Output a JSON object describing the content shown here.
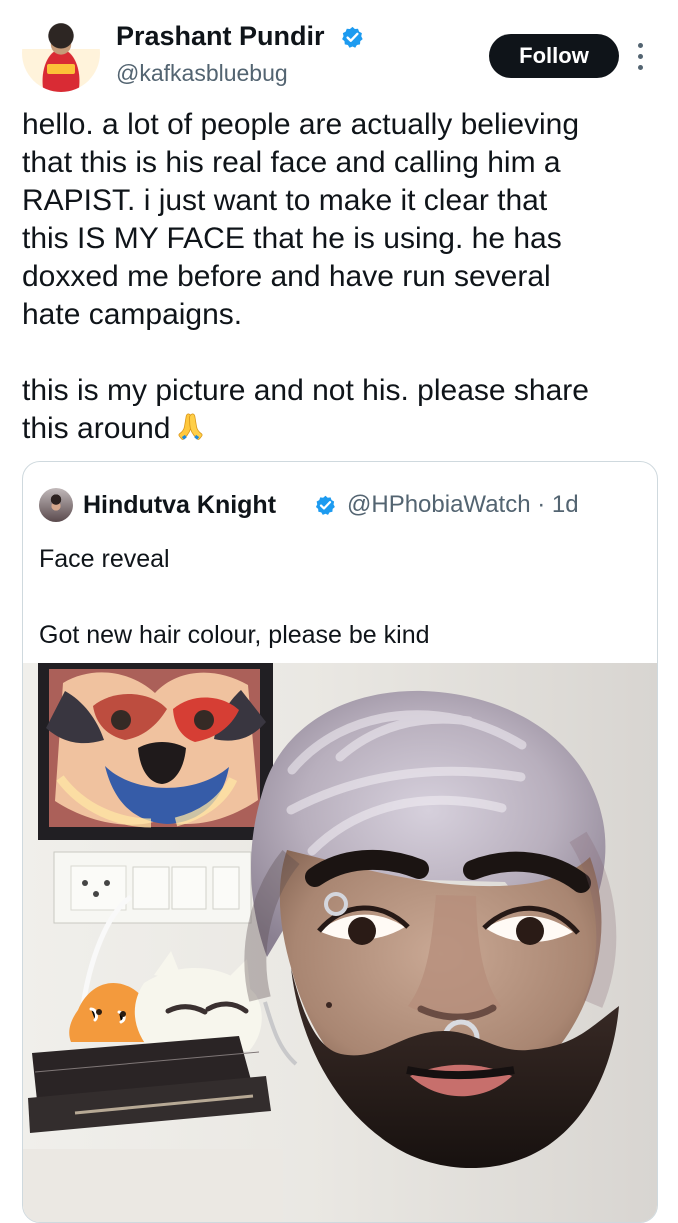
{
  "tweet": {
    "author": {
      "display_name": "Prashant Pundir",
      "handle": "@kafkasbluebug",
      "verified_icon": "verified-badge-icon"
    },
    "follow_label": "Follow",
    "more_icon": "more-vertical-icon",
    "text": "hello. a lot of people are actually believing\nthat this is his real face and calling him a\nRAPIST. i just want to make it clear that\nthis IS MY FACE that he is using. he has\ndoxxed me before and have run several\nhate campaigns.\n\nthis is my picture and not his. please share\nthis around",
    "emoji": "🙏",
    "quoted_tweet": {
      "display_name": "Hindutva Knight",
      "handle_date": "@HPhobiaWatch · 1d",
      "text": "Face reveal\n\nGot new hair colour,  please be kind",
      "photo_description_icon": "selfie-photo"
    }
  },
  "colors": {
    "text_primary": "#0f1419",
    "text_secondary": "#536471",
    "follow_button": "#0f1419",
    "verified_blue": "#1d9bf0",
    "border": "#cfd9de"
  }
}
